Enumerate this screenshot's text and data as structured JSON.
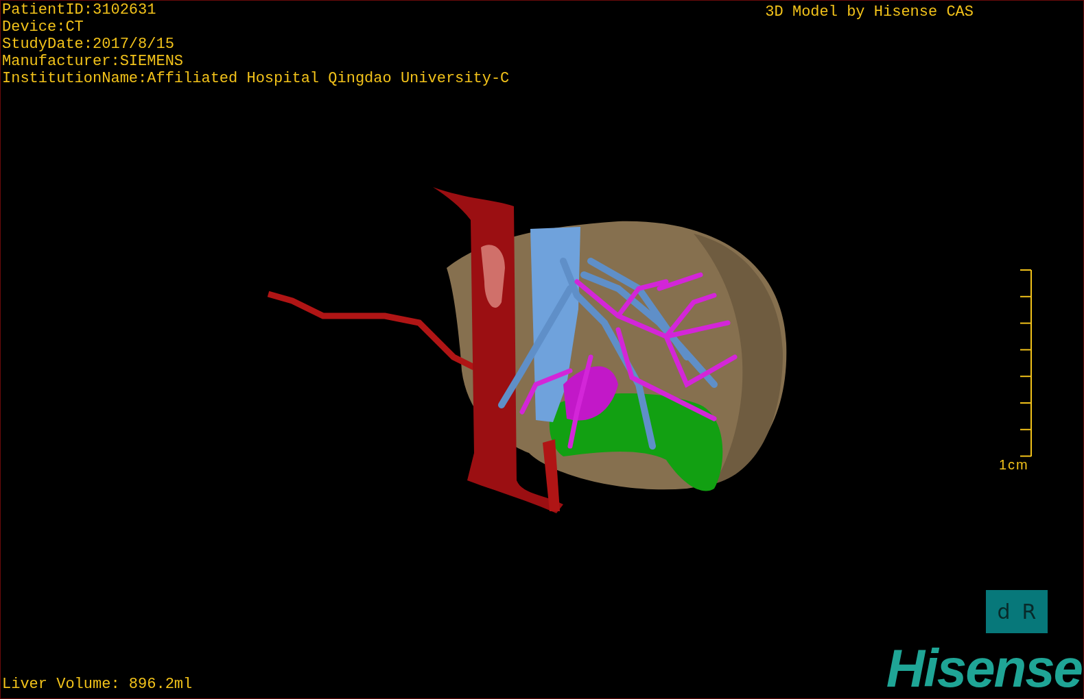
{
  "patient_info": [
    "PatientID:3102631",
    "Device:CT",
    "StudyDate:2017/8/15",
    "Manufacturer:SIEMENS",
    "InstitutionName:Affiliated Hospital Qingdao University-C"
  ],
  "title": "3D Model by Hisense CAS",
  "scale_bar": {
    "label": "1cm"
  },
  "orientation_cube": {
    "labels": [
      "d",
      "R"
    ]
  },
  "liver_volume": "Liver Volume: 896.2ml",
  "logo": "Hisense"
}
